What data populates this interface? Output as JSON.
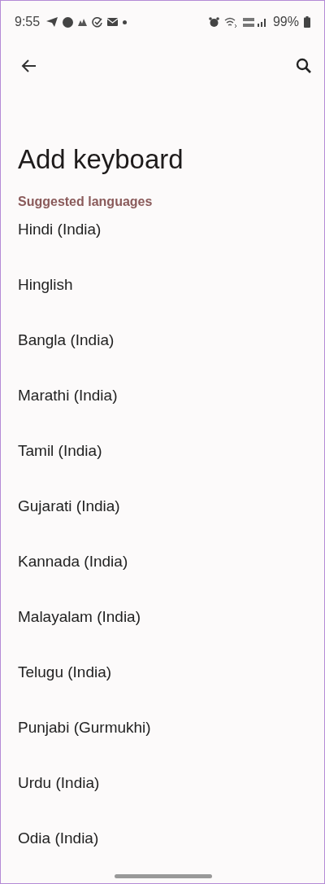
{
  "status_bar": {
    "time": "9:55",
    "battery": "99%"
  },
  "title": "Add keyboard",
  "section": "Suggested languages",
  "languages": [
    "Hindi (India)",
    "Hinglish",
    "Bangla (India)",
    "Marathi (India)",
    "Tamil (India)",
    "Gujarati (India)",
    "Kannada (India)",
    "Malayalam (India)",
    "Telugu (India)",
    "Punjabi (Gurmukhi)",
    "Urdu (India)",
    "Odia (India)"
  ]
}
